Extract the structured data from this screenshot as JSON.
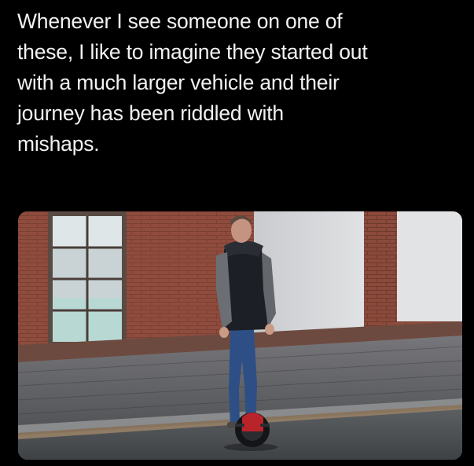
{
  "meme": {
    "caption_lines": [
      "Whenever I see someone on one of",
      "these, I like to imagine they started out",
      "with a much larger vehicle and their",
      "journey has been riddled with",
      "mishaps."
    ]
  },
  "photo": {
    "subject": "man-riding-electric-unicycle",
    "colors": {
      "brick": "#8a4a3c",
      "pale_wall": "#d9dbde",
      "pavement": "#5d6063",
      "jeans": "#2d4f86",
      "vest": "#1c2026"
    }
  }
}
